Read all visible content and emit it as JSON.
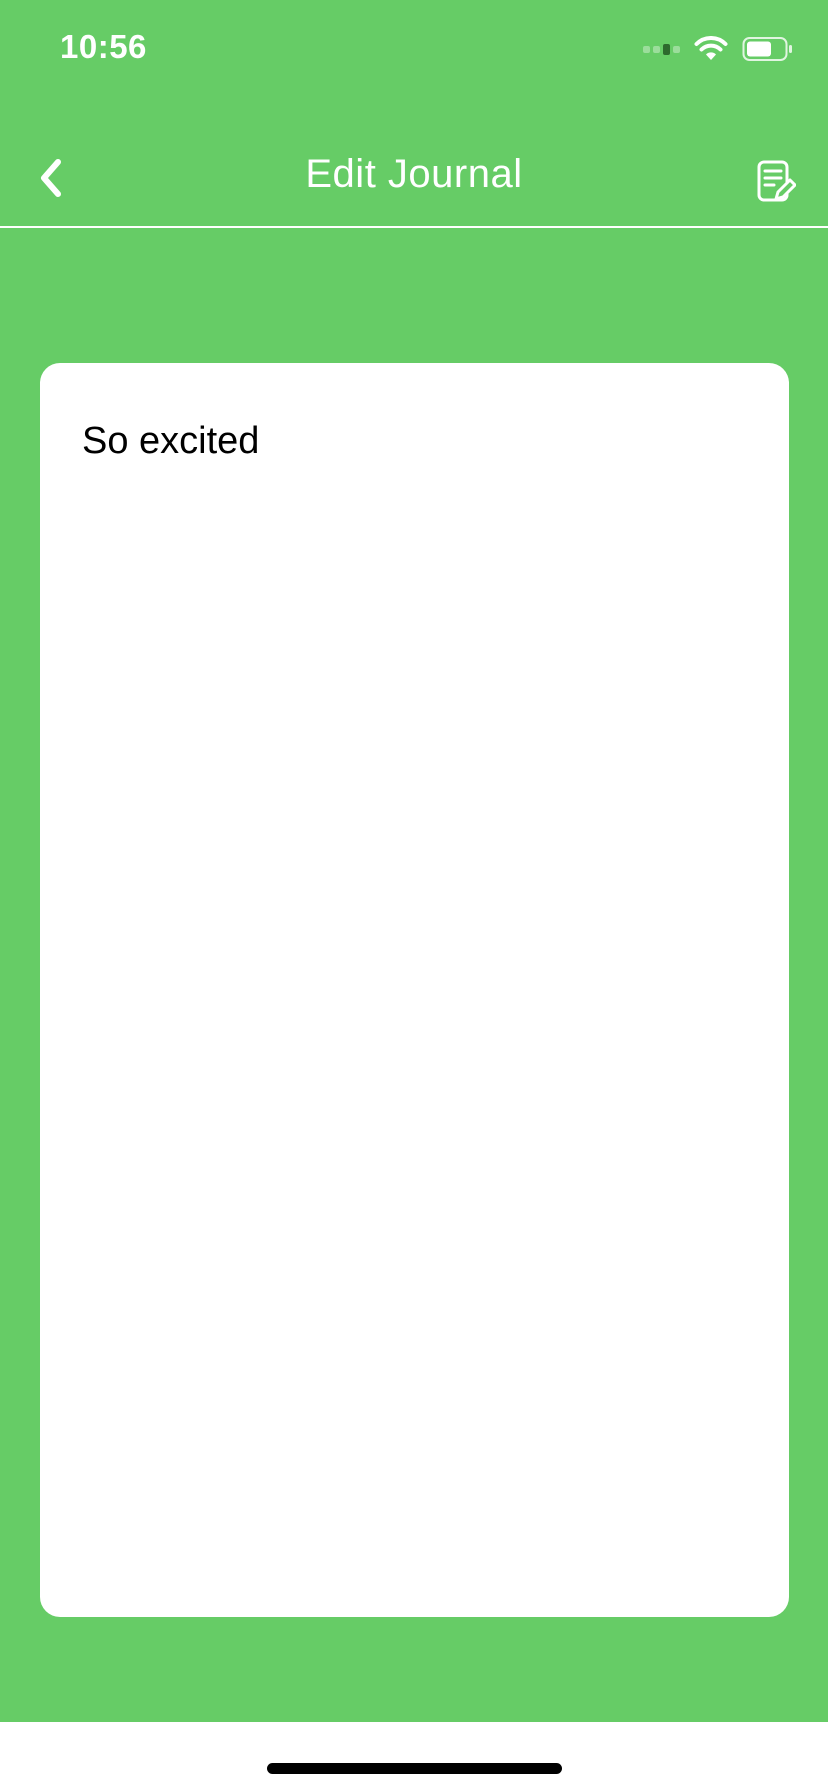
{
  "status_bar": {
    "time": "10:56"
  },
  "nav": {
    "title": "Edit Journal",
    "back_icon": "chevron-left-icon",
    "action_icon": "edit-note-icon"
  },
  "journal": {
    "text": "So excited"
  },
  "colors": {
    "background": "#66cc66",
    "card": "#ffffff",
    "text": "#000000"
  }
}
